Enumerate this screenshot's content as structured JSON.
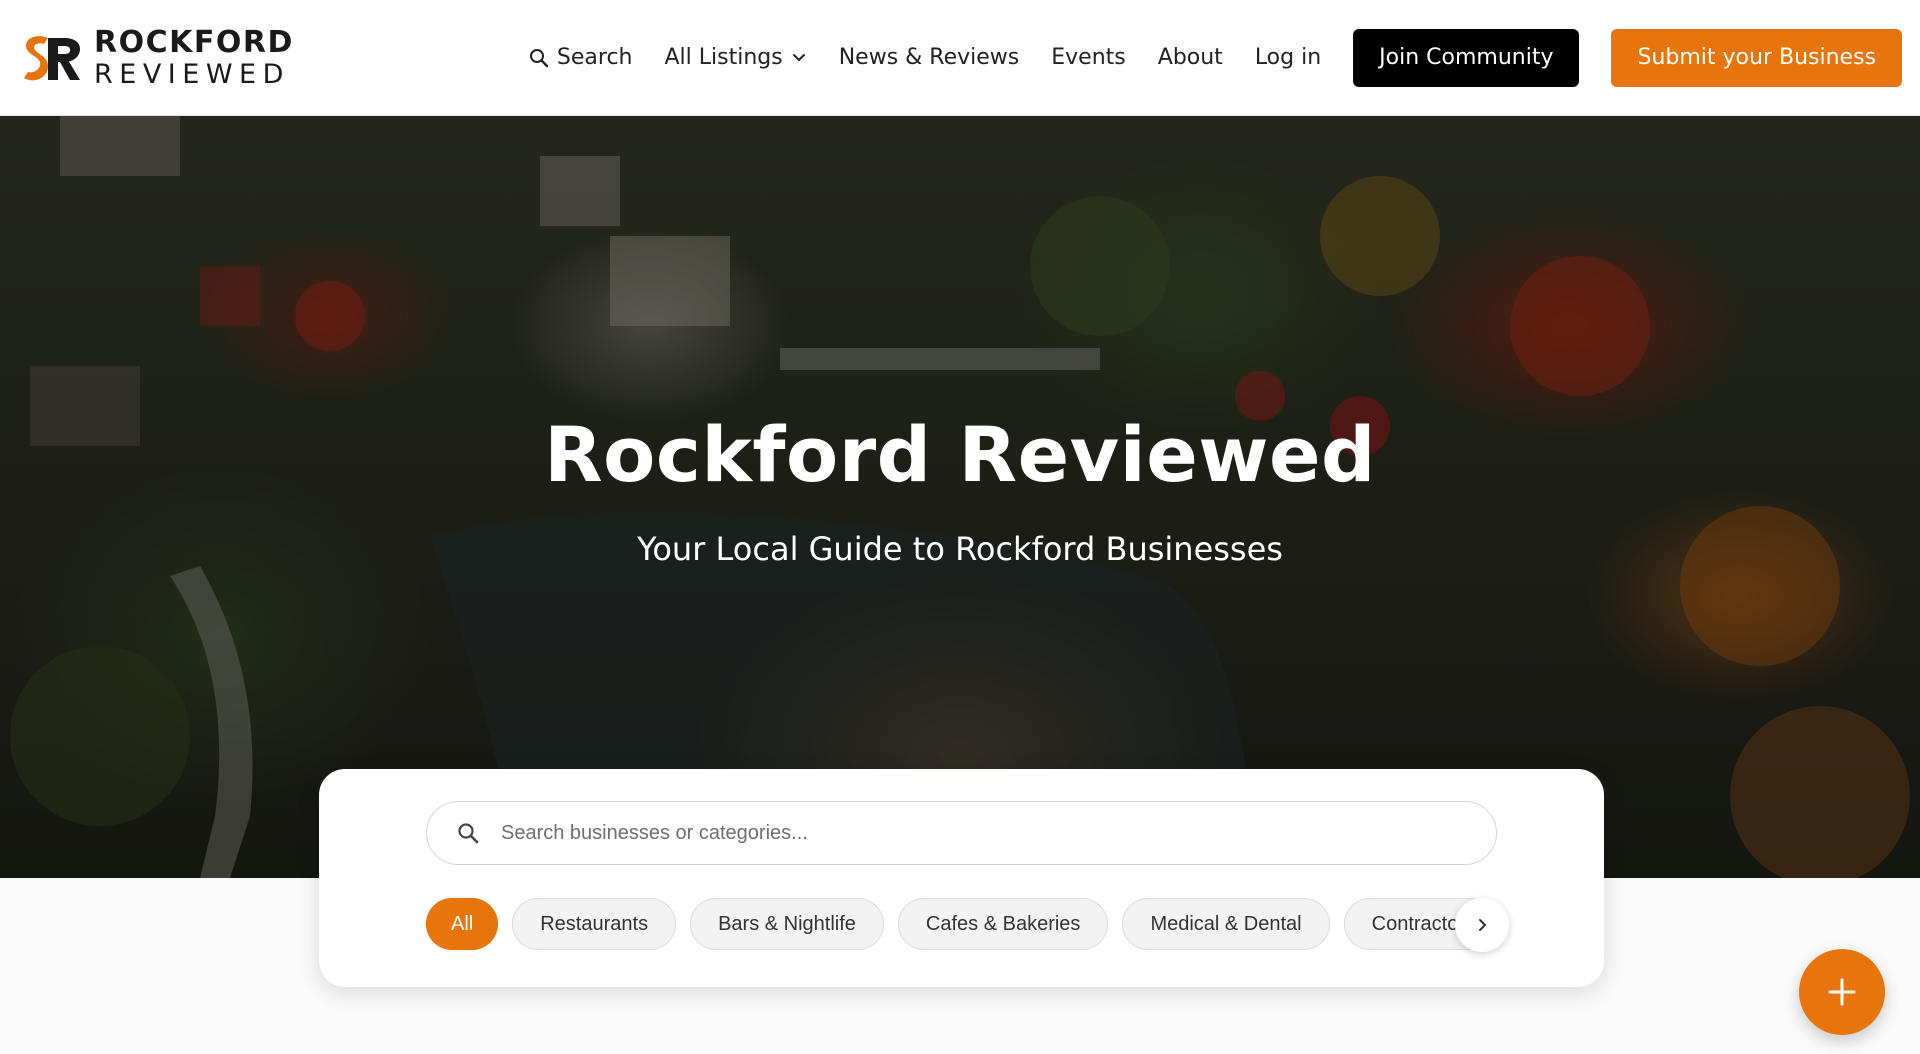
{
  "brand": {
    "name_line1": "ROCKFORD",
    "name_line2": "REVIEWED",
    "logo_icon": "rr-logo-mark",
    "accent_color": "#e8740c"
  },
  "nav": {
    "search_label": "Search",
    "search_icon": "search-icon",
    "listings_label": "All Listings",
    "listings_icon": "chevron-down-icon",
    "news_label": "News & Reviews",
    "events_label": "Events",
    "about_label": "About",
    "login_label": "Log in",
    "join_label": "Join Community",
    "submit_label": "Submit your Business"
  },
  "hero": {
    "title": "Rockford Reviewed",
    "subtitle": "Your Local Guide to Rockford Businesses"
  },
  "search": {
    "placeholder": "Search businesses or categories...",
    "icon": "search-icon"
  },
  "categories": {
    "items": [
      "All",
      "Restaurants",
      "Bars & Nightlife",
      "Cafes & Bakeries",
      "Medical & Dental",
      "Contractors"
    ],
    "selected": "All",
    "next_icon": "chevron-right-icon"
  },
  "fab": {
    "icon": "plus-icon"
  },
  "colors": {
    "accent": "#e8740c",
    "join_button_bg": "#000000",
    "header_bg": "#ffffff",
    "chip_bg": "#f3f3f3"
  }
}
